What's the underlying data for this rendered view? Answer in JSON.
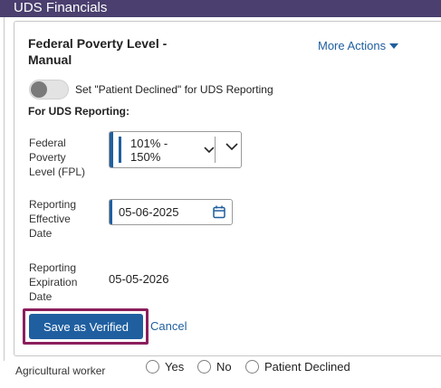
{
  "header": {
    "title": "UDS Financials"
  },
  "card": {
    "title": "Federal Poverty Level - Manual",
    "more_actions": "More Actions",
    "toggle_label": "Set \"Patient Declined\" for UDS Reporting",
    "section_label": "For UDS Reporting:",
    "fpl": {
      "label": "Federal Poverty Level (FPL)",
      "value": "101% - 150%"
    },
    "effective_date": {
      "label": "Reporting Effective Date",
      "value": "05-06-2025"
    },
    "expiration_date": {
      "label": "Reporting Expiration Date",
      "value": "05-05-2026"
    },
    "save_label": "Save as Verified",
    "cancel_label": "Cancel"
  },
  "agricultural": {
    "label": "Agricultural worker",
    "options": [
      "Yes",
      "No",
      "Patient Declined"
    ]
  },
  "colors": {
    "header_bg": "#4a3f6e",
    "accent": "#1f5fa0",
    "highlight_outline": "#8b1e5c"
  }
}
